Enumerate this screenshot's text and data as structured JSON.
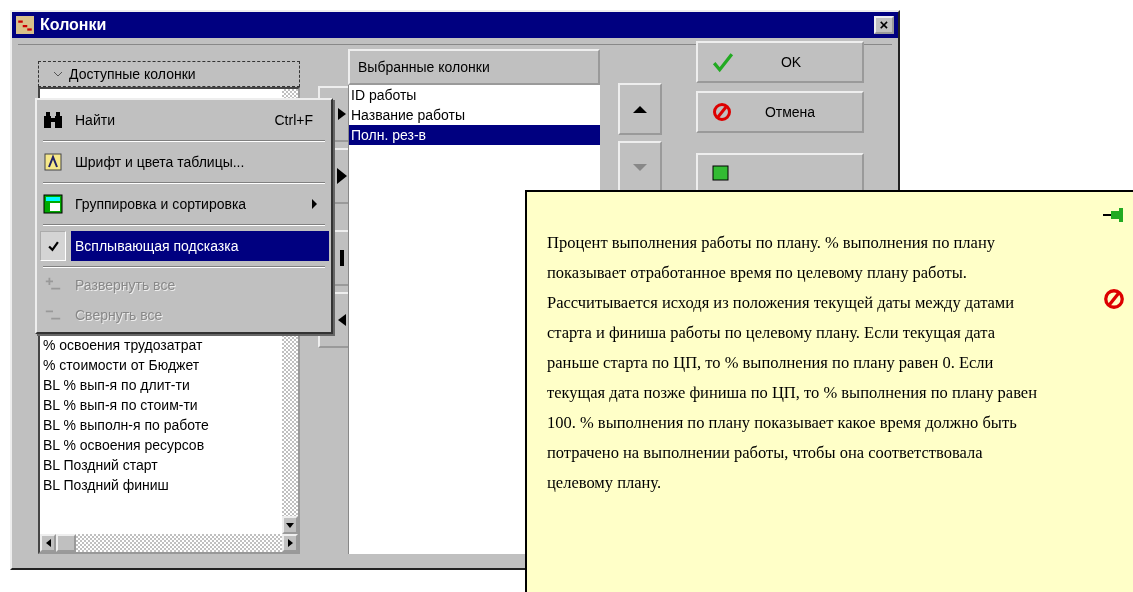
{
  "window": {
    "title": "Колонки",
    "close": "×"
  },
  "available": {
    "header": "Доступные колонки",
    "items": [
      {
        "label": "% освоения трудозатрат"
      },
      {
        "label": "% стоимости от Бюджет"
      },
      {
        "label": "BL % вып-я по длит-ти"
      },
      {
        "label": "BL % вып-я по стоим-ти"
      },
      {
        "label": "BL % выполн-я по работе"
      },
      {
        "label": "BL % освоения ресурсов"
      },
      {
        "label": "BL Поздний старт"
      },
      {
        "label": "BL Поздний финиш"
      }
    ]
  },
  "context_menu": [
    {
      "kind": "item",
      "label": "Найти",
      "shortcut": "Ctrl+F",
      "submenu": false,
      "checked": false,
      "disabled": false,
      "selected": false
    },
    {
      "kind": "separator"
    },
    {
      "kind": "item",
      "label": "Шрифт и цвета таблицы...",
      "submenu": false,
      "checked": false,
      "disabled": false,
      "selected": false
    },
    {
      "kind": "separator"
    },
    {
      "kind": "item",
      "label": "Группировка и сортировка",
      "submenu": true,
      "checked": false,
      "disabled": false,
      "selected": false
    },
    {
      "kind": "separator"
    },
    {
      "kind": "item",
      "label": "Всплывающая подсказка",
      "submenu": false,
      "checked": true,
      "disabled": false,
      "selected": true
    },
    {
      "kind": "separator"
    },
    {
      "kind": "item",
      "label": "Развернуть все",
      "submenu": false,
      "checked": false,
      "disabled": true,
      "selected": false
    },
    {
      "kind": "item",
      "label": "Свернуть все",
      "submenu": false,
      "checked": false,
      "disabled": true,
      "selected": false
    }
  ],
  "selected_columns": {
    "header": "Выбранные колонки",
    "items": [
      {
        "label": "ID работы",
        "selected": false
      },
      {
        "label": "Название работы",
        "selected": false
      },
      {
        "label": "Полн. рез-в",
        "selected": true
      }
    ]
  },
  "order_buttons": [
    {
      "kind": "up",
      "disabled": false
    },
    {
      "kind": "down",
      "disabled": true
    }
  ],
  "buttons": [
    {
      "kind": "ok",
      "label": "OK"
    },
    {
      "kind": "cancel",
      "label": "Отмена"
    },
    {
      "kind": "document"
    }
  ],
  "tooltip": {
    "text": "Процент выполнения работы по плану. % выполнения по плану показывает отработанное время по целевому плану работы. Рассчитывается исходя из положения текущей даты между датами старта и финиша работы по целевому плану. Если текущая дата раньше старта по ЦП, то % выполнения по плану равен 0. Если текущая дата позже финиша по ЦП, то % выполнения по плану равен 100. % выполнения по плану показывает какое время должно быть потрачено на выполнении работы, чтобы она соответствовала целевому плану."
  }
}
